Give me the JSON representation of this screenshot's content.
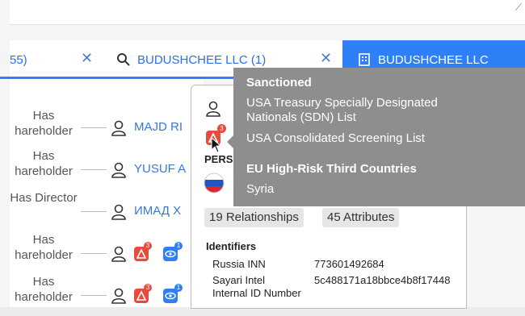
{
  "tabs": {
    "a_label": "55)",
    "b_label": "BUDUSHCHEE LLC (1)",
    "c_label": "BUDUSHCHEE LLC"
  },
  "rows": [
    {
      "rel": "Has hareholder",
      "name": "MAJD RI",
      "red_count": "",
      "blue_count": ""
    },
    {
      "rel": "Has hareholder",
      "name": "YUSUF A",
      "red_count": "",
      "blue_count": ""
    },
    {
      "rel": "Has Director",
      "name": "ИМАД Х",
      "red_count": "",
      "blue_count": ""
    },
    {
      "rel": "Has hareholder",
      "name": "",
      "red_count": "3",
      "blue_count": "1"
    },
    {
      "rel": "Has hareholder",
      "name": "",
      "red_count": "3",
      "blue_count": "1"
    }
  ],
  "panel": {
    "entity_type": "PERS",
    "alert_count": "3",
    "relationships": "19 Relationships",
    "attributes": "45 Attributes",
    "identifiers_title": "Identifiers",
    "identifiers": [
      {
        "key": "Russia INN",
        "value": "773601492684"
      },
      {
        "key": "Sayari Intel Internal ID Number",
        "value": "5c488171a18bbce4b8f17448"
      }
    ]
  },
  "tooltip": {
    "section1_title": "Sanctioned",
    "section1_items": [
      "USA Treasury Specially Designated Nationals (SDN) List",
      "USA Consolidated Screening List"
    ],
    "section2_title": "EU High-Risk Third Countries",
    "section2_items": [
      "Syria"
    ]
  },
  "colors": {
    "accent": "#2f7ff6",
    "alert": "#e84a3b",
    "tooltip_bg": "#8e8e8e"
  }
}
